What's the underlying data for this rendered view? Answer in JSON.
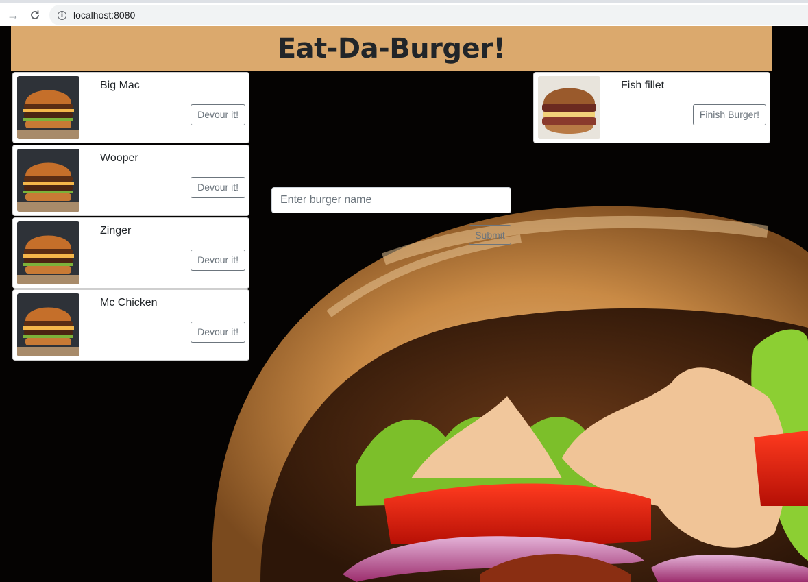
{
  "browser": {
    "url": "localhost:8080"
  },
  "header": {
    "title": "Eat-Da-Burger!"
  },
  "uneaten": {
    "items": [
      {
        "name": "Big Mac",
        "button": "Devour it!"
      },
      {
        "name": "Wooper",
        "button": "Devour it!"
      },
      {
        "name": "Zinger",
        "button": "Devour it!"
      },
      {
        "name": "Mc Chicken",
        "button": "Devour it!"
      }
    ]
  },
  "devoured": {
    "items": [
      {
        "name": "Fish fillet",
        "button": "Finish Burger!"
      }
    ]
  },
  "form": {
    "placeholder": "Enter burger name",
    "value": "",
    "submit_label": "Submit"
  },
  "colors": {
    "header_bg": "#dba96d",
    "button_border": "#6c757d"
  }
}
